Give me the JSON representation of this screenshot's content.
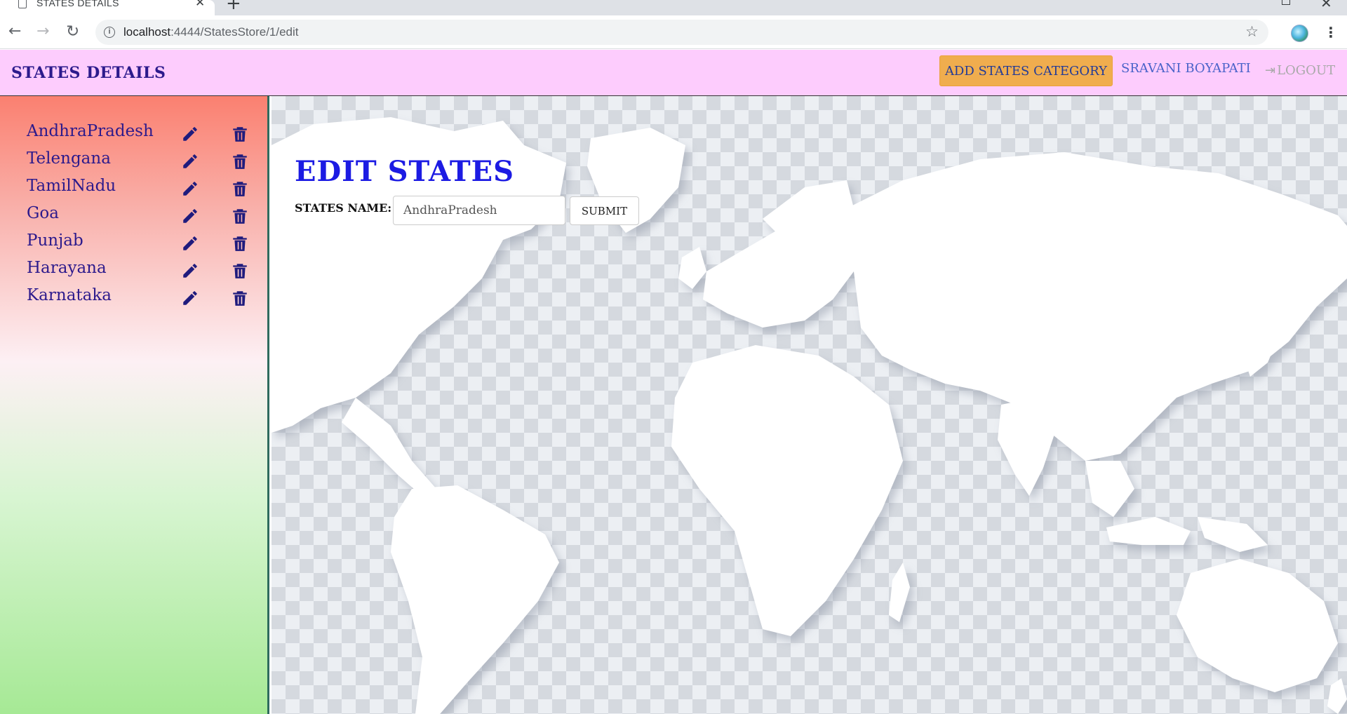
{
  "browser": {
    "tab_title": "STATES DETAILS",
    "url_host": "localhost",
    "url_rest": ":4444/StatesStore/1/edit"
  },
  "navbar": {
    "brand": "STATES DETAILS",
    "add_category_label": "ADD STATES CATEGORY",
    "user_name": "SRAVANI BOYAPATI",
    "logout_label": "LOGOUT"
  },
  "sidebar": {
    "states": [
      {
        "name": "AndhraPradesh"
      },
      {
        "name": "Telengana"
      },
      {
        "name": "TamilNadu"
      },
      {
        "name": "Goa"
      },
      {
        "name": "Punjab"
      },
      {
        "name": "Harayana"
      },
      {
        "name": "Karnataka"
      }
    ]
  },
  "form": {
    "title": "EDIT STATES",
    "name_label": "STATES NAME:",
    "name_value": "AndhraPradesh",
    "submit_label": "SUBMIT"
  },
  "colors": {
    "brand_text": "#2c1a8c",
    "title_blue": "#1c1be3",
    "navbar_bg": "#fdccfd",
    "add_button": "#f0ad4e"
  }
}
